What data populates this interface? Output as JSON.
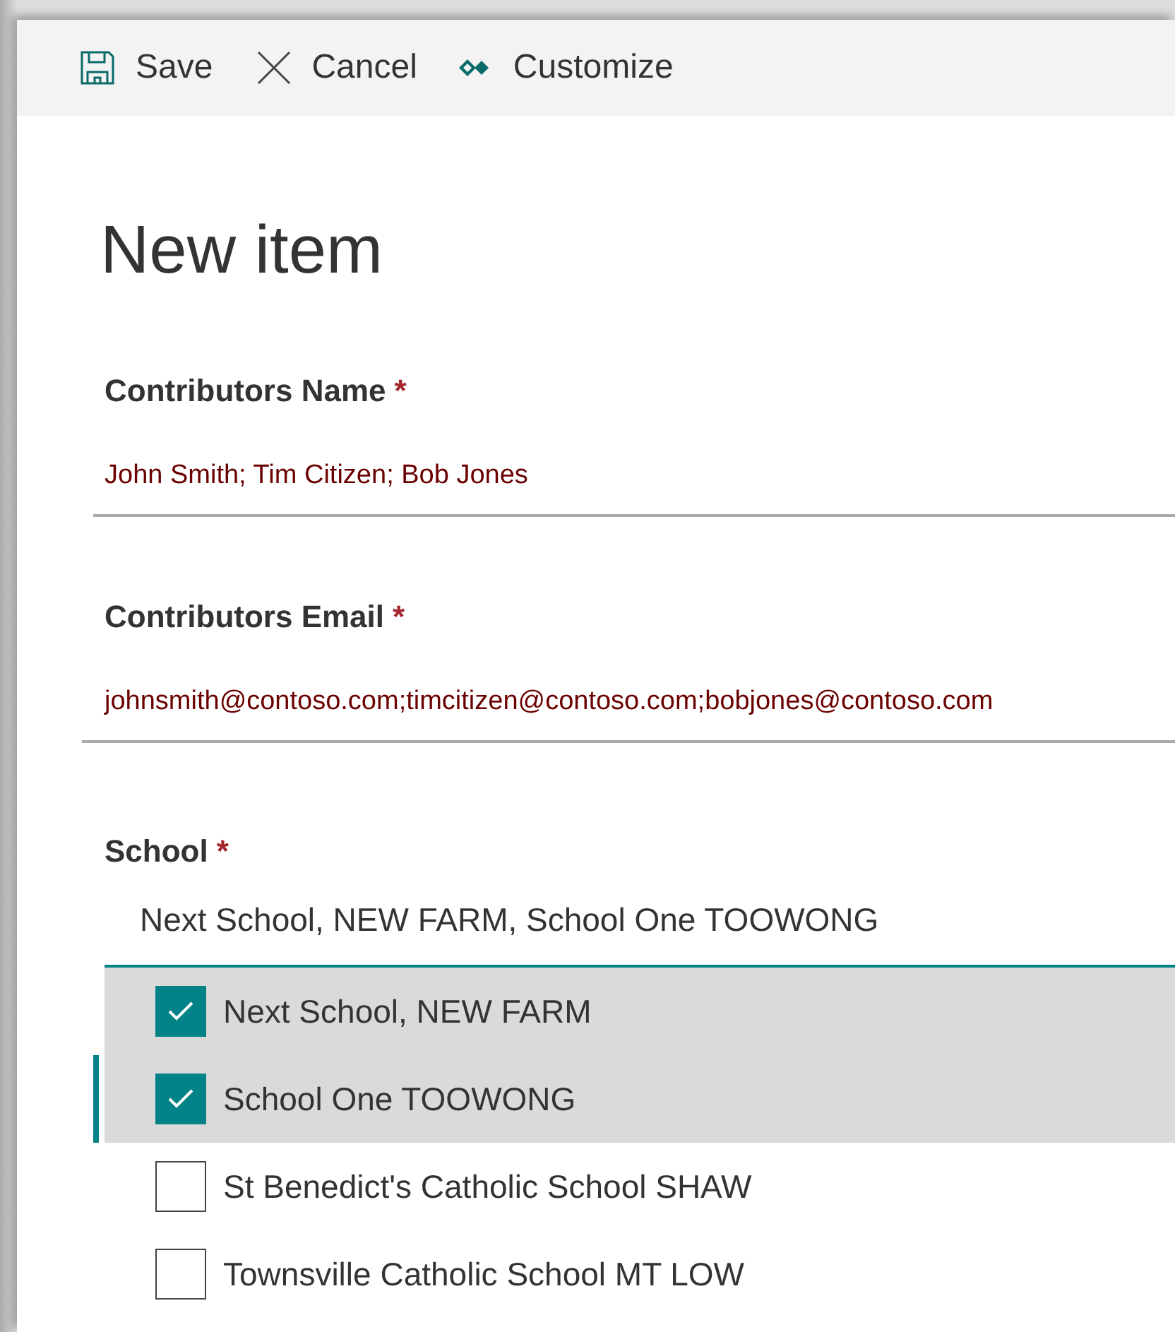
{
  "toolbar": [
    {
      "kind": "save",
      "label": "Save"
    },
    {
      "kind": "cancel",
      "label": "Cancel"
    },
    {
      "kind": "customize",
      "label": "Customize"
    }
  ],
  "title": "New item",
  "fields": [
    {
      "label": "Contributors Name",
      "required_mark": "*",
      "value": "John Smith; Tim Citizen; Bob Jones"
    },
    {
      "label": "Contributors Email",
      "required_mark": "*",
      "value": "johnsmith@contoso.com;timcitizen@contoso.com;bobjones@contoso.com"
    }
  ],
  "school": {
    "label": "School",
    "required_mark": "*",
    "value": "Next School, NEW FARM, School One TOOWONG",
    "options": [
      {
        "label": "Next School, NEW FARM",
        "checked": true,
        "focused": false
      },
      {
        "label": "School One TOOWONG",
        "checked": true,
        "focused": true
      },
      {
        "label": "St Benedict's Catholic School SHAW",
        "checked": false,
        "focused": false
      },
      {
        "label": "Townsville Catholic School MT LOW",
        "checked": false,
        "focused": false
      }
    ]
  }
}
